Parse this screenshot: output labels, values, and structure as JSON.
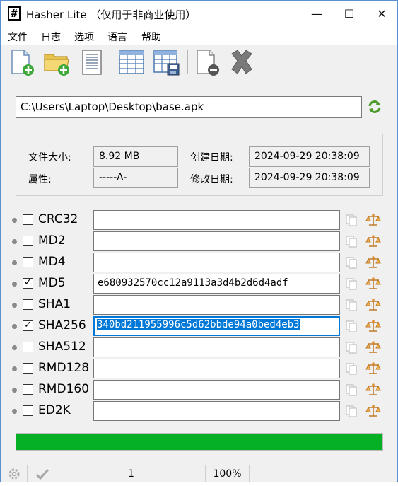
{
  "window": {
    "title": "Hasher Lite （仅用于非商业使用）",
    "app_icon_glyph": "#",
    "minimize_glyph": "—",
    "maximize_glyph": "☐",
    "close_glyph": "✕"
  },
  "menu": [
    "文件",
    "日志",
    "选项",
    "语言",
    "帮助"
  ],
  "toolbar": [
    "new-file-icon",
    "open-folder-icon",
    "document-icon",
    "table-icon",
    "save-table-icon",
    "remove-file-icon",
    "close-x-icon"
  ],
  "path": {
    "value": "C:\\Users\\Laptop\\Desktop\\base.apk"
  },
  "info": {
    "size_label": "文件大小:",
    "size_value": "8.92 MB",
    "attr_label": "属性:",
    "attr_value": "-----A-",
    "created_label": "创建日期:",
    "created_value": "2024-09-29 20:38:09",
    "modified_label": "修改日期:",
    "modified_value": "2024-09-29 20:38:09"
  },
  "hashes": [
    {
      "algo": "CRC32",
      "checked": false,
      "value": ""
    },
    {
      "algo": "MD2",
      "checked": false,
      "value": ""
    },
    {
      "algo": "MD4",
      "checked": false,
      "value": ""
    },
    {
      "algo": "MD5",
      "checked": true,
      "value": "e680932570cc12a9113a3d4b2d6d4adf"
    },
    {
      "algo": "SHA1",
      "checked": false,
      "value": ""
    },
    {
      "algo": "SHA256",
      "checked": true,
      "value": "340bd211955996c5d62bbde94a0bed4eb3",
      "selected": true
    },
    {
      "algo": "SHA512",
      "checked": false,
      "value": ""
    },
    {
      "algo": "RMD128",
      "checked": false,
      "value": ""
    },
    {
      "algo": "RMD160",
      "checked": false,
      "value": ""
    },
    {
      "algo": "ED2K",
      "checked": false,
      "value": ""
    }
  ],
  "progress": {
    "fraction": 1.0,
    "color": "#06b025"
  },
  "status": {
    "count": "1",
    "zoom": "100%"
  }
}
